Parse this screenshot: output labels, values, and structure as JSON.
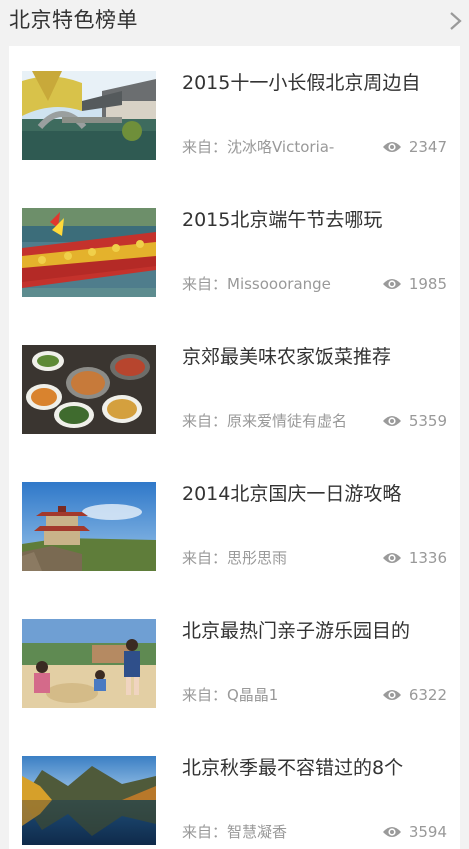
{
  "header": {
    "title": "北京特色榜单",
    "more_icon": "chevron-right-icon"
  },
  "colors": {
    "background": "#f2f2f2",
    "card": "#ffffff",
    "title_text": "#333333",
    "meta_text": "#999999"
  },
  "items": [
    {
      "title": "2015十一小长假北京周边自",
      "author": "来自：沈冰咯Victoria-",
      "views": "2347",
      "thumb": "water-town-bridge-photo"
    },
    {
      "title": "2015北京端午节去哪玩",
      "author": "来自：Missooorange",
      "views": "1985",
      "thumb": "dragon-boat-race-photo"
    },
    {
      "title": "京郊最美味农家饭菜推荐",
      "author": "来自：原来爱情徒有虚名",
      "views": "5359",
      "thumb": "farmhouse-dishes-photo"
    },
    {
      "title": "2014北京国庆一日游攻略",
      "author": "来自：思彤思雨",
      "views": "1336",
      "thumb": "pagoda-tower-photo"
    },
    {
      "title": "北京最热门亲子游乐园目的",
      "author": "来自：Q晶晶1",
      "views": "6322",
      "thumb": "kids-playing-sand-photo"
    },
    {
      "title": "北京秋季最不容错过的8个",
      "author": "来自：智慧凝香",
      "views": "3594",
      "thumb": "autumn-lake-photo"
    }
  ]
}
